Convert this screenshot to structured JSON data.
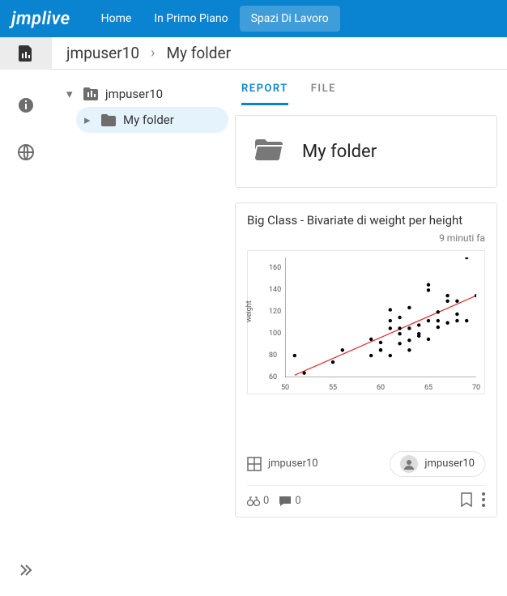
{
  "brand": "jmplive",
  "topnav": {
    "items": [
      {
        "label": "Home",
        "active": false
      },
      {
        "label": "In Primo Piano",
        "active": false
      },
      {
        "label": "Spazi Di Lavoro",
        "active": true
      }
    ]
  },
  "breadcrumbs": {
    "root": "jmpuser10",
    "current": "My folder"
  },
  "tree": {
    "root_label": "jmpuser10",
    "child_label": "My folder"
  },
  "tabs": {
    "report": "REPORT",
    "file": "FILE",
    "active": "report"
  },
  "folder": {
    "title": "My folder"
  },
  "report": {
    "title": "Big Class - Bivariate di weight per height",
    "time": "9 minuti fa",
    "data_owner": "jmpuser10",
    "author": "jmpuser10",
    "eyes_count": "0",
    "comments_count": "0"
  },
  "chart_data": {
    "type": "scatter",
    "title": "",
    "xlabel": "",
    "ylabel": "weight",
    "xlim": [
      50,
      70
    ],
    "ylim": [
      60,
      170
    ],
    "xticks": [
      50,
      55,
      60,
      65,
      70
    ],
    "yticks": [
      60,
      80,
      100,
      120,
      140,
      160
    ],
    "points": [
      {
        "x": 51,
        "y": 80
      },
      {
        "x": 52,
        "y": 64
      },
      {
        "x": 55,
        "y": 74
      },
      {
        "x": 56,
        "y": 85
      },
      {
        "x": 59,
        "y": 80
      },
      {
        "x": 59,
        "y": 95
      },
      {
        "x": 60,
        "y": 85
      },
      {
        "x": 60,
        "y": 85
      },
      {
        "x": 60,
        "y": 92
      },
      {
        "x": 61,
        "y": 80
      },
      {
        "x": 61,
        "y": 105
      },
      {
        "x": 61,
        "y": 112
      },
      {
        "x": 61,
        "y": 122
      },
      {
        "x": 62,
        "y": 91
      },
      {
        "x": 62,
        "y": 100
      },
      {
        "x": 62,
        "y": 105
      },
      {
        "x": 62,
        "y": 115
      },
      {
        "x": 63,
        "y": 85
      },
      {
        "x": 63,
        "y": 94
      },
      {
        "x": 63,
        "y": 105
      },
      {
        "x": 63,
        "y": 124
      },
      {
        "x": 64,
        "y": 100
      },
      {
        "x": 64,
        "y": 108
      },
      {
        "x": 64,
        "y": 98
      },
      {
        "x": 65,
        "y": 95
      },
      {
        "x": 65,
        "y": 112
      },
      {
        "x": 65,
        "y": 140
      },
      {
        "x": 65,
        "y": 145
      },
      {
        "x": 66,
        "y": 106
      },
      {
        "x": 66,
        "y": 112
      },
      {
        "x": 66,
        "y": 120
      },
      {
        "x": 67,
        "y": 110
      },
      {
        "x": 67,
        "y": 130
      },
      {
        "x": 67,
        "y": 135
      },
      {
        "x": 68,
        "y": 112
      },
      {
        "x": 68,
        "y": 130
      },
      {
        "x": 68,
        "y": 118
      },
      {
        "x": 69,
        "y": 112
      },
      {
        "x": 69,
        "y": 170
      },
      {
        "x": 70,
        "y": 135
      }
    ],
    "fit_line": {
      "x1": 51,
      "y1": 62,
      "x2": 70,
      "y2": 135
    }
  }
}
